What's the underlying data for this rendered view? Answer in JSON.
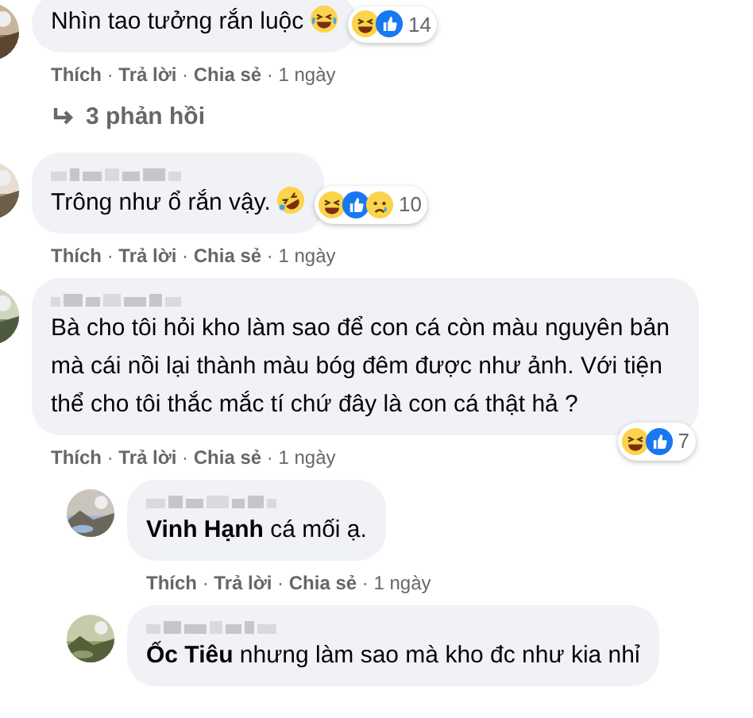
{
  "comments": [
    {
      "text": "Nhìn tao tưởng rắn luộc",
      "trailing_emoji": {
        "kind": "laugh"
      },
      "reactions": {
        "icons": [
          {
            "kind": "haha"
          },
          {
            "kind": "like"
          }
        ],
        "count": "14"
      },
      "actions": [
        "Thích",
        "Trả lời",
        "Chia sẻ"
      ],
      "separator": "·",
      "time": "1 ngày",
      "replies_link": "3 phản hồi"
    },
    {
      "author_blurred": true,
      "text": "Trông như ổ rắn vậy.",
      "trailing_emoji": {
        "kind": "rofl"
      },
      "reactions": {
        "icons": [
          {
            "kind": "haha"
          },
          {
            "kind": "like"
          },
          {
            "kind": "sad"
          }
        ],
        "count": "10"
      },
      "actions": [
        "Thích",
        "Trả lời",
        "Chia sẻ"
      ],
      "separator": "·",
      "time": "1 ngày"
    },
    {
      "author_blurred": true,
      "text": "Bà cho tôi hỏi kho làm sao để con cá còn màu nguyên bản mà cái nồi lại thành màu bóg đêm được như ảnh. Với tiện thể cho tôi thắc mắc tí chứ đây là con cá thật hả ?",
      "reactions": {
        "icons": [
          {
            "kind": "haha"
          },
          {
            "kind": "like"
          }
        ],
        "count": "7"
      },
      "actions": [
        "Thích",
        "Trả lời",
        "Chia sẻ"
      ],
      "separator": "·",
      "time": "1 ngày",
      "replies": [
        {
          "author_blurred": true,
          "text": "**Vinh Hạnh** cá mối ạ.",
          "actions": [
            "Thích",
            "Trả lời",
            "Chia sẻ"
          ],
          "separator": "·",
          "time": "1 ngày"
        },
        {
          "author_blurred": true,
          "text": "**Ốc Tiêu** nhưng làm sao mà kho đc như kia nhỉ"
        }
      ]
    }
  ]
}
